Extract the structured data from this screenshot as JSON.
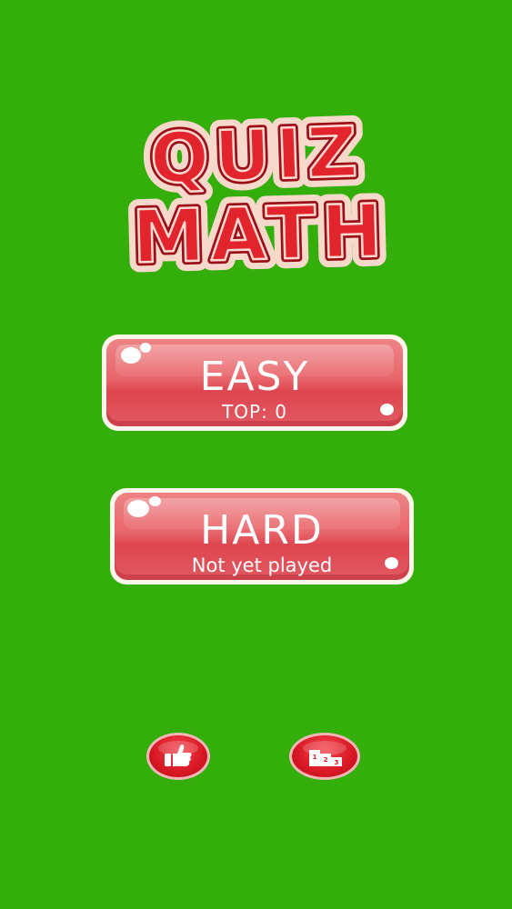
{
  "logo": {
    "line1": "QUIZ",
    "line2": "MATH"
  },
  "menu": {
    "easy": {
      "label": "EASY",
      "score_text": "TOP: 0"
    },
    "hard": {
      "label": "HARD",
      "score_text": "Not yet played"
    }
  },
  "footer": {
    "like_icon": "thumbs-up-icon",
    "leaderboard_icon": "podium-icon"
  },
  "colors": {
    "background": "#33ae0a",
    "button_red": "#e8676d",
    "logo_red": "#e2242c",
    "logo_outline": "#fbe6dc"
  }
}
